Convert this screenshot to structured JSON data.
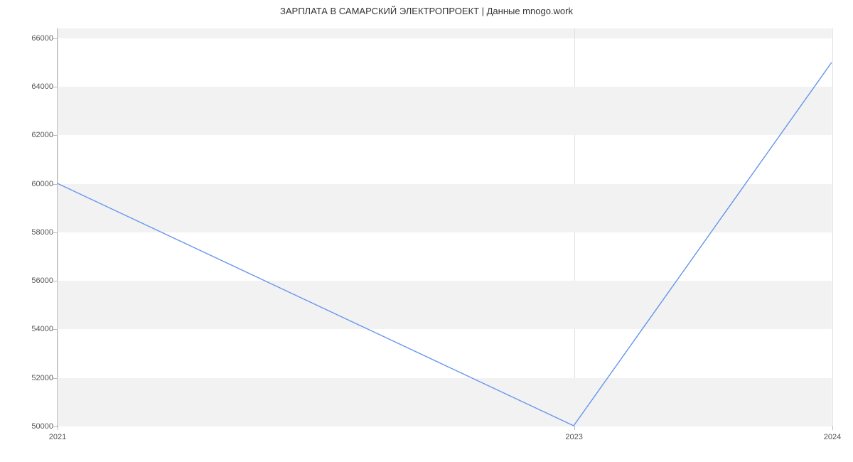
{
  "chart_data": {
    "type": "line",
    "title": "ЗАРПЛАТА В САМАРСКИЙ ЭЛЕКТРОПРОЕКТ | Данные mnogo.work",
    "xlabel": "",
    "ylabel": "",
    "x": [
      2021,
      2023,
      2024
    ],
    "values": [
      60000,
      50000,
      65000
    ],
    "x_ticks": [
      2021,
      2023,
      2024
    ],
    "y_ticks": [
      50000,
      52000,
      54000,
      56000,
      58000,
      60000,
      62000,
      64000,
      66000
    ],
    "xlim": [
      2021,
      2024
    ],
    "ylim": [
      50000,
      66400
    ],
    "line_color": "#6495ED",
    "band_color": "#f2f2f2",
    "bands": [
      [
        50000,
        52000
      ],
      [
        54000,
        56000
      ],
      [
        58000,
        60000
      ],
      [
        62000,
        64000
      ],
      [
        66000,
        66400
      ]
    ]
  }
}
